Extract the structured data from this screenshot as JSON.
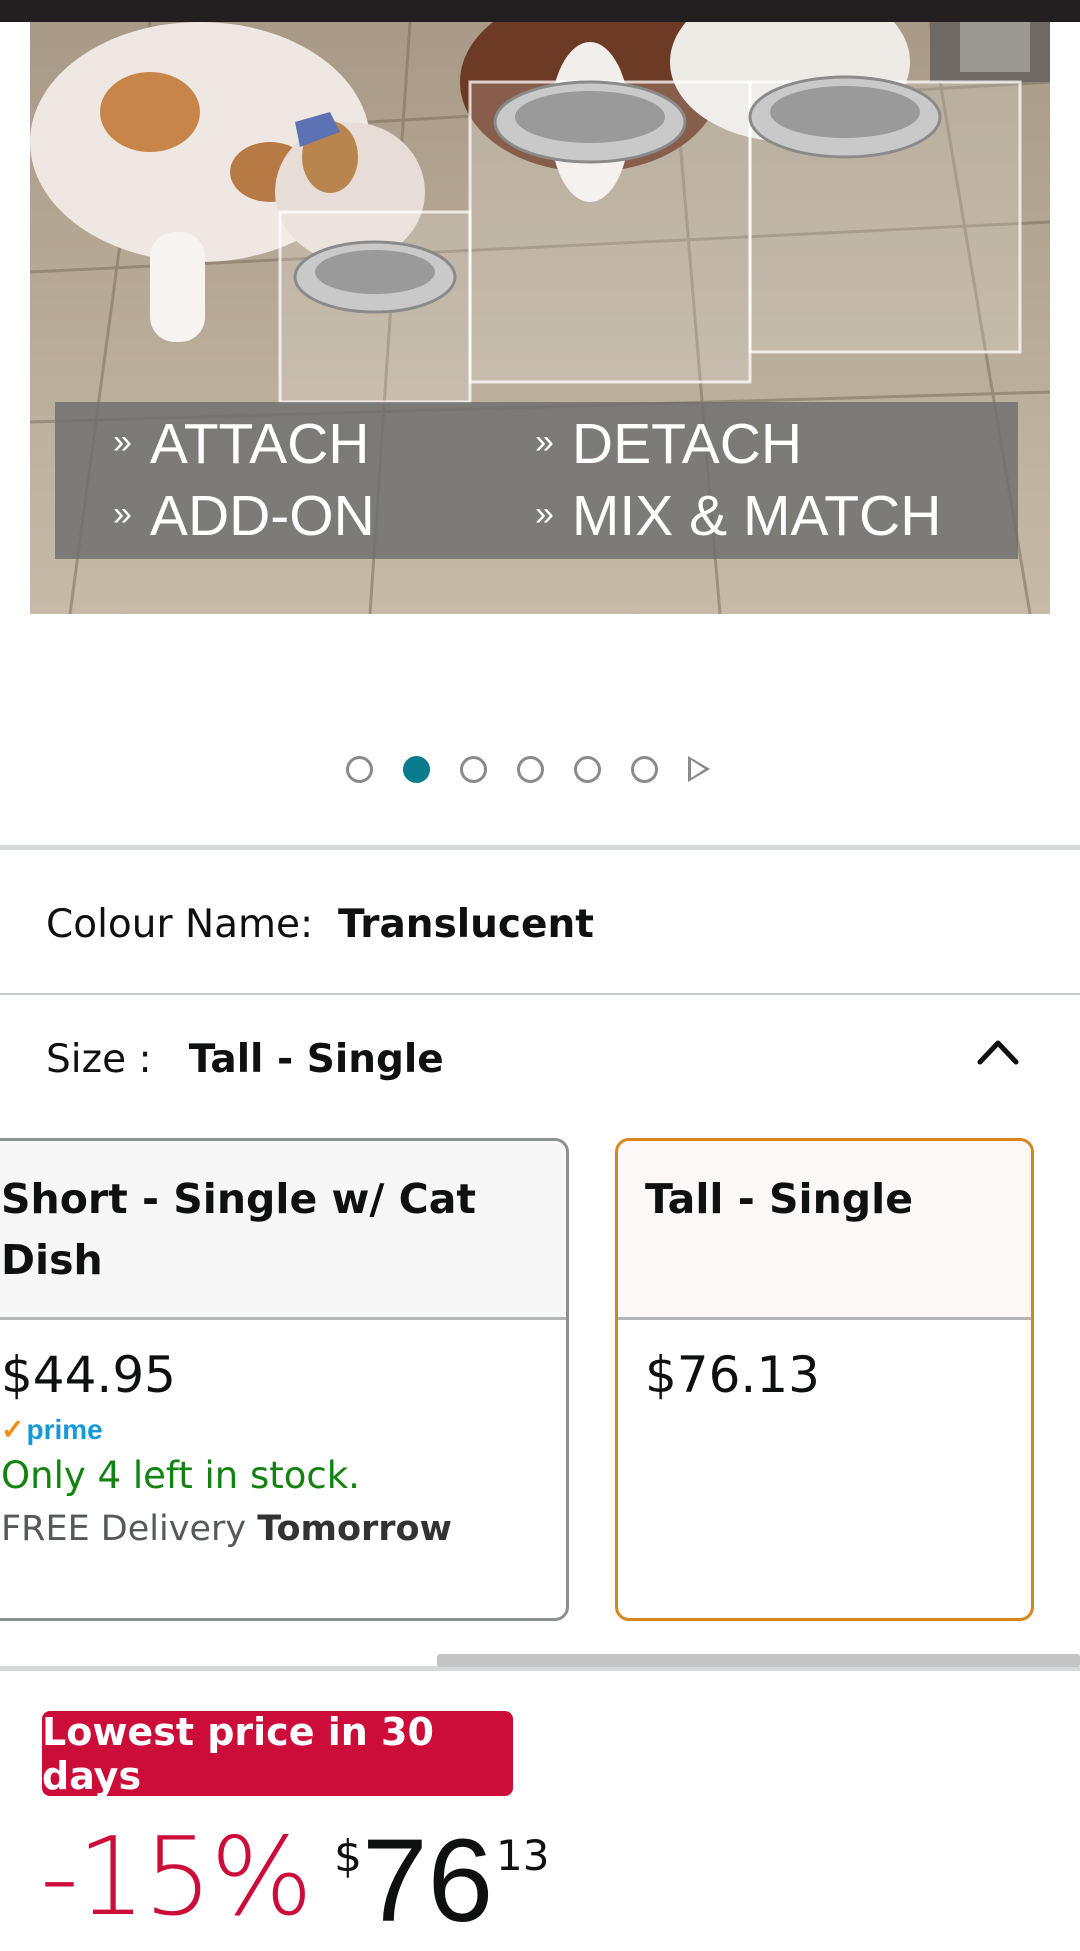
{
  "hero": {
    "features": [
      "ATTACH",
      "ADD-ON",
      "DETACH",
      "MIX & MATCH"
    ],
    "feature_bullet_icon": "double-chevron-icon"
  },
  "gallery": {
    "image_count": 6,
    "active_index": 1
  },
  "colour": {
    "label": "Colour Name:",
    "value": "Translucent"
  },
  "size": {
    "label": "Size :",
    "value": "Tall - Single",
    "options": [
      {
        "title": "Short - Single w/ Cat Dish",
        "price": "$44.95",
        "prime": "prime",
        "stock": "Only 4 left in stock.",
        "delivery_prefix": "FREE Delivery",
        "delivery_day": "Tomorrow"
      },
      {
        "title": "Tall - Single",
        "price": "$76.13"
      }
    ]
  },
  "deal": {
    "badge": "Lowest price in 30 days",
    "discount": "-15%",
    "currency": "$",
    "whole": "76",
    "fraction": "13"
  },
  "colors": {
    "accent": "#087b8c",
    "deal": "#cc0c39",
    "selected": "#d7871a",
    "stock": "#12830f"
  }
}
